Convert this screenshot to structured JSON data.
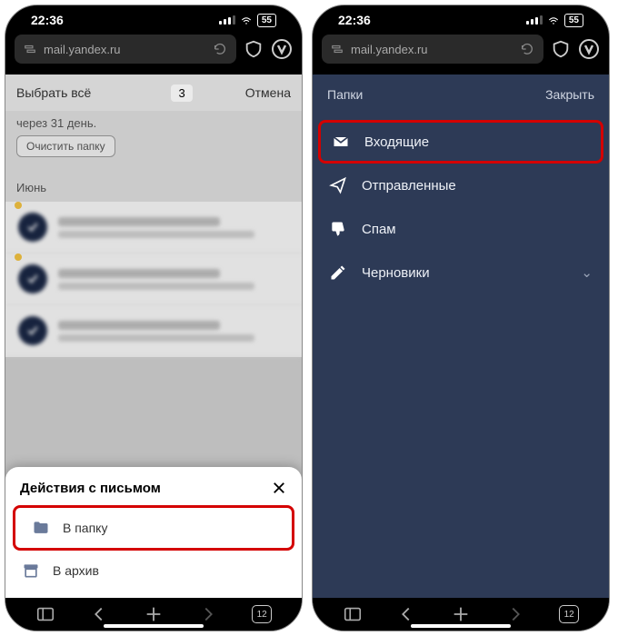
{
  "status": {
    "time": "22:36",
    "battery": "55"
  },
  "url": "mail.yandex.ru",
  "left": {
    "select_all": "Выбрать всё",
    "count": "3",
    "cancel": "Отмена",
    "info": "через 31 день.",
    "clear": "Очистить папку",
    "month": "Июнь",
    "sheet_title": "Действия с письмом",
    "to_folder": "В папку",
    "to_archive": "В архив"
  },
  "right": {
    "folders": "Папки",
    "close": "Закрыть",
    "items": [
      {
        "label": "Входящие"
      },
      {
        "label": "Отправленные"
      },
      {
        "label": "Спам"
      },
      {
        "label": "Черновики"
      }
    ]
  },
  "tabs": "12"
}
